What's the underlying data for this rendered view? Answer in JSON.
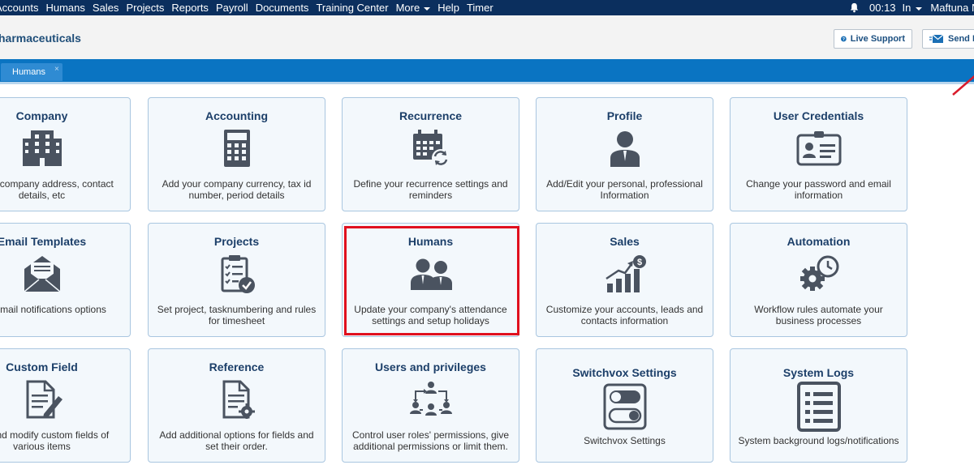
{
  "topnav": {
    "items": [
      "Accounts",
      "Humans",
      "Sales",
      "Projects",
      "Reports",
      "Payroll",
      "Documents",
      "Training Center",
      "More",
      "Help",
      "Timer"
    ],
    "time": "00:13",
    "clock_status": "In",
    "user": "Maftuna N"
  },
  "header": {
    "company": "harmaceuticals",
    "live_support": "Live Support",
    "send": "Send F"
  },
  "tabs": [
    {
      "label": "Humans",
      "close": "×"
    }
  ],
  "tiles": [
    {
      "title": "Company",
      "desc": "e your company address, contact details, etc",
      "icon": "building-icon"
    },
    {
      "title": "Accounting",
      "desc": "Add your company currency, tax id number, period details",
      "icon": "calculator-icon"
    },
    {
      "title": "Recurrence",
      "desc": "Define your recurrence settings and reminders",
      "icon": "calendar-refresh-icon"
    },
    {
      "title": "Profile",
      "desc": "Add/Edit your personal, professional Information",
      "icon": "person-icon"
    },
    {
      "title": "User Credentials",
      "desc": "Change your password and email information",
      "icon": "id-card-icon"
    },
    {
      "title": "Email Templates",
      "desc": "Set email notifications options",
      "icon": "envelope-icon"
    },
    {
      "title": "Projects",
      "desc": "Set project, tasknumbering and rules for timesheet",
      "icon": "clipboard-check-icon"
    },
    {
      "title": "Humans",
      "desc": "Update your company's attendance settings and setup holidays",
      "icon": "people-icon"
    },
    {
      "title": "Sales",
      "desc": "Customize your accounts, leads and contacts information",
      "icon": "sales-chart-icon"
    },
    {
      "title": "Automation",
      "desc": "Workflow rules automate your business processes",
      "icon": "gear-clock-icon"
    },
    {
      "title": "Custom Field",
      "desc": "ete and modify custom fields of various items",
      "icon": "document-pen-icon"
    },
    {
      "title": "Reference",
      "desc": "Add additional options for fields and set their order.",
      "icon": "document-gear-icon"
    },
    {
      "title": "Users and privileges",
      "desc": "Control user roles' permissions, give additional permissions or limit them.",
      "icon": "user-hierarchy-icon"
    },
    {
      "title": "Switchvox Settings",
      "desc": "Switchvox Settings",
      "icon": "toggle-switch-icon"
    },
    {
      "title": "System Logs",
      "desc": "System background logs/notifications",
      "icon": "list-document-icon"
    }
  ],
  "colors": {
    "nav": "#0b2f5e",
    "tab_strip": "#0a74c2",
    "tile_bg": "#f3f8fc",
    "tile_border": "#a9c6e0",
    "icon": "#4a5360",
    "highlight": "#e0101e"
  }
}
